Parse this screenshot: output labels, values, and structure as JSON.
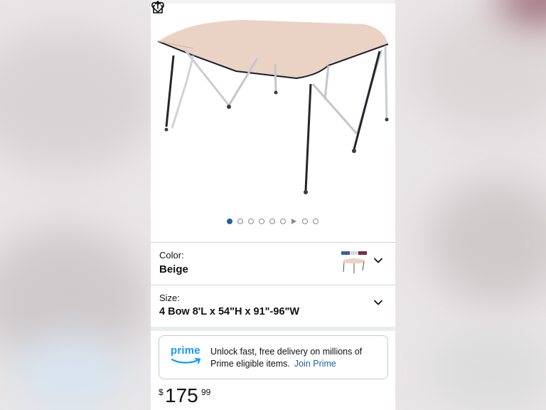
{
  "gallery": {
    "dot_count": 8,
    "active_index": 0,
    "video_index": 5
  },
  "actions": {
    "wishlist_icon": "heart-icon",
    "share_icon": "share-icon"
  },
  "color": {
    "label": "Color:",
    "value": "Beige"
  },
  "size": {
    "label": "Size:",
    "value": "4 Bow 8'L x 54\"H x 91\"-96\"W"
  },
  "prime": {
    "logo_text": "prime",
    "message": "Unlock fast, free delivery on millions of Prime eligible items.",
    "link": "Join Prime"
  },
  "price": {
    "symbol": "$",
    "whole": "175",
    "fraction": "99"
  },
  "colors": {
    "accent_blue": "#2162a1",
    "canopy_beige": "#ead3c4",
    "prime_blue": "#1399ff"
  }
}
